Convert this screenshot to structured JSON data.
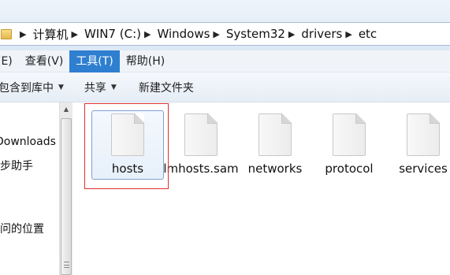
{
  "addressbar": {
    "crumbs": [
      "计算机",
      "WIN7 (C:)",
      "Windows",
      "System32",
      "drivers",
      "etc"
    ]
  },
  "menu": {
    "items": [
      "(E)",
      "查看(V)",
      "工具(T)",
      "帮助(H)"
    ],
    "active_index": 2
  },
  "toolbar": {
    "include_in_library": "包含到库中",
    "share": "共享",
    "new_folder": "新建文件夹"
  },
  "navpane": {
    "items": [
      "Downloads",
      "步助手",
      "问的位置"
    ]
  },
  "files": [
    {
      "name": "hosts",
      "selected": true
    },
    {
      "name": "lmhosts.sam",
      "selected": false
    },
    {
      "name": "networks",
      "selected": false
    },
    {
      "name": "protocol",
      "selected": false
    },
    {
      "name": "services",
      "selected": false
    }
  ],
  "colors": {
    "menu_active": "#2f7fd1",
    "highlight_box": "#e0302c"
  }
}
